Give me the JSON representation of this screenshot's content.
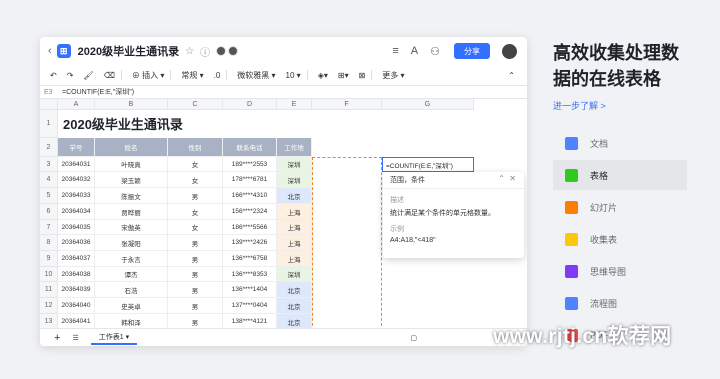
{
  "window": {
    "title": "2020级毕业生通讯录",
    "share_label": "分享",
    "toolbar": {
      "insert": "插入",
      "format": "常规",
      "decimal": ".0",
      "font": "微软雅黑",
      "size": "10",
      "more": "更多"
    },
    "formula_bar": {
      "cell_ref": "E3",
      "formula": "=COUNTIF(E:E,\"深圳\")"
    },
    "columns": [
      "A",
      "B",
      "C",
      "D",
      "E",
      "F",
      "G"
    ],
    "rows": [
      "1",
      "2",
      "3",
      "4",
      "5",
      "6",
      "7",
      "8",
      "9",
      "10",
      "11",
      "12",
      "13"
    ],
    "sheet_title": "2020级毕业生通讯录",
    "headers": [
      "学号",
      "姓名",
      "性别",
      "联系电话",
      "工作地"
    ],
    "data": [
      [
        "20364031",
        "叶晓真",
        "女",
        "189****2553",
        "深圳"
      ],
      [
        "20364032",
        "梁玉颖",
        "女",
        "178****6781",
        "深圳"
      ],
      [
        "20364033",
        "陈振文",
        "男",
        "166****4310",
        "北京"
      ],
      [
        "20364034",
        "贾晔丽",
        "女",
        "156****2324",
        "上海"
      ],
      [
        "20364035",
        "宋傲英",
        "女",
        "186****5566",
        "上海"
      ],
      [
        "20364036",
        "张凝阳",
        "男",
        "139****2426",
        "上海"
      ],
      [
        "20364037",
        "于永言",
        "男",
        "136****6758",
        "上海"
      ],
      [
        "20364038",
        "谭杰",
        "男",
        "136****8353",
        "深圳"
      ],
      [
        "20364039",
        "石浩",
        "男",
        "136****1404",
        "北京"
      ],
      [
        "20364040",
        "史英卓",
        "男",
        "137****0404",
        "北京"
      ],
      [
        "20364041",
        "韩和泽",
        "男",
        "138****4121",
        "北京"
      ]
    ],
    "active_formula": "=COUNTIF(E:E,\"深圳\")",
    "tooltip": {
      "title": "范围，条件",
      "desc_label": "描述",
      "desc": "统计满足某个条件的单元格数量。",
      "example_label": "示例",
      "example": "A4:A18,\"<418\""
    },
    "sheet_tab": "工作表1"
  },
  "sidebar": {
    "heading": "高效收集处理数据的在线表格",
    "link": "进一步了解 >",
    "items": [
      {
        "label": "文档",
        "color": "#4e83fd"
      },
      {
        "label": "表格",
        "color": "#34c724"
      },
      {
        "label": "幻灯片",
        "color": "#ff7d00"
      },
      {
        "label": "收集表",
        "color": "#ffc60a"
      },
      {
        "label": "思维导图",
        "color": "#7f3bf5"
      },
      {
        "label": "流程图",
        "color": "#4e83fd"
      },
      {
        "label": "PDF",
        "color": "#f54a45"
      }
    ]
  },
  "watermark": "www.rjtj.cn软荐网",
  "colors": {
    "shenzhen": "#e8f4e4",
    "shanghai": "#fdf0e0",
    "beijing": "#dde8fb",
    "header": "#a9b2c4",
    "accent": "#3370ff"
  }
}
